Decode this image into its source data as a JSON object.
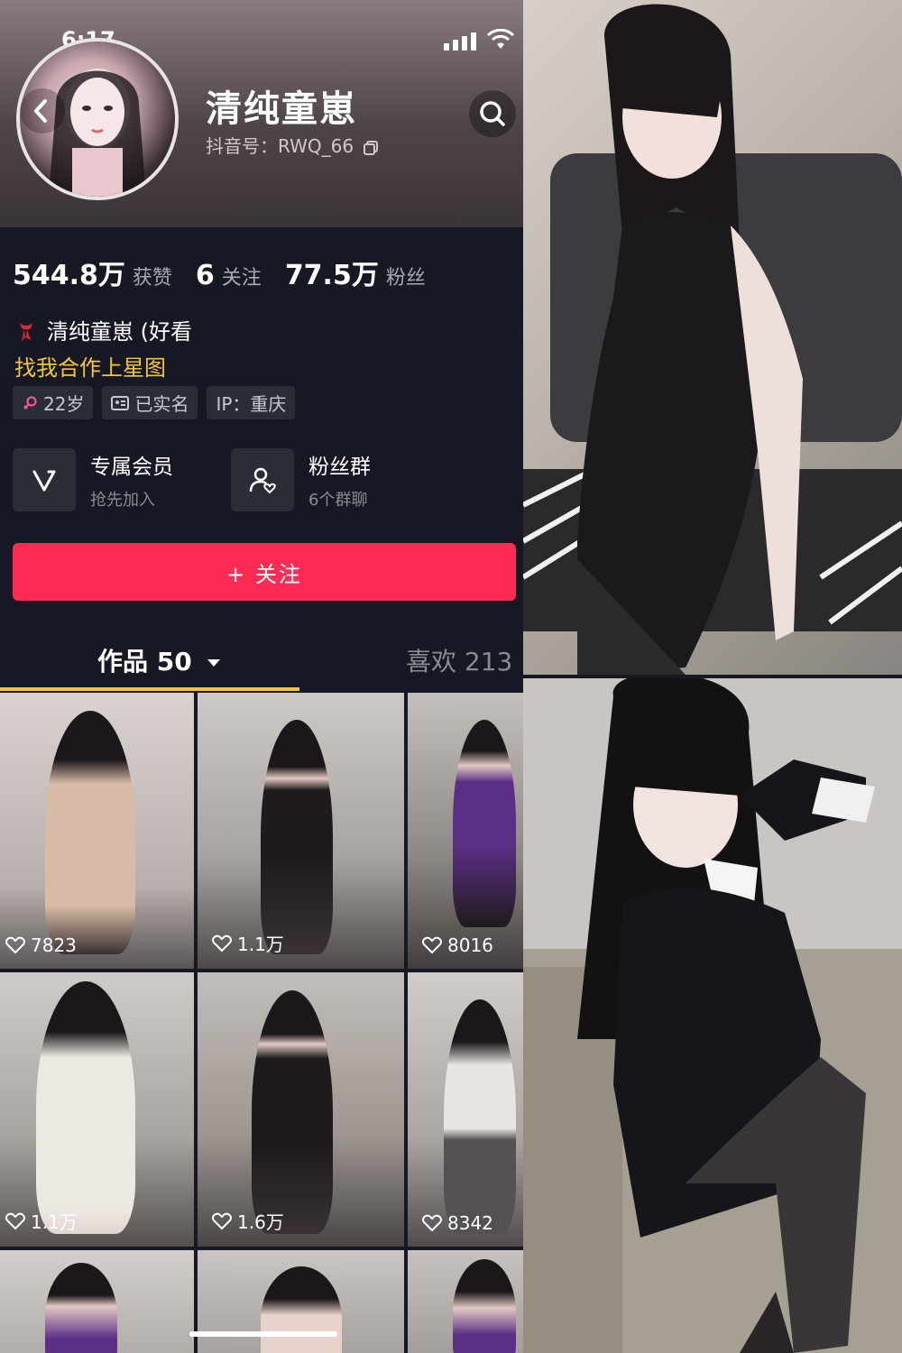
{
  "status_bar": {
    "time": "6:17"
  },
  "profile": {
    "name": "清纯童崽",
    "douyin_id": "抖音号：RWQ_66",
    "stats": [
      {
        "value": "544.8万",
        "label": "获赞"
      },
      {
        "value": "6",
        "label": "关注"
      },
      {
        "value": "77.5万",
        "label": "粉丝"
      }
    ],
    "bio_line1": "清纯童崽 (好看",
    "bio_link": "找我合作上星图",
    "tags": {
      "age": "22岁",
      "verified": "已实名",
      "ip": "IP：重庆"
    }
  },
  "cards": {
    "member_title": "专属会员",
    "member_sub": "抢先加入",
    "fans_title": "粉丝群",
    "fans_sub": "6个群聊"
  },
  "follow_button": "+ 关注",
  "tabs": {
    "works": "作品 50",
    "likes": "喜欢 213"
  },
  "grid_likes": [
    "7823",
    "1.1万",
    "8016",
    "1.1万",
    "1.6万",
    "8342"
  ],
  "colors": {
    "accent": "#fe2c55",
    "tab_indicator": "#f4c63a",
    "link": "#f4c63a",
    "background": "#161823"
  }
}
